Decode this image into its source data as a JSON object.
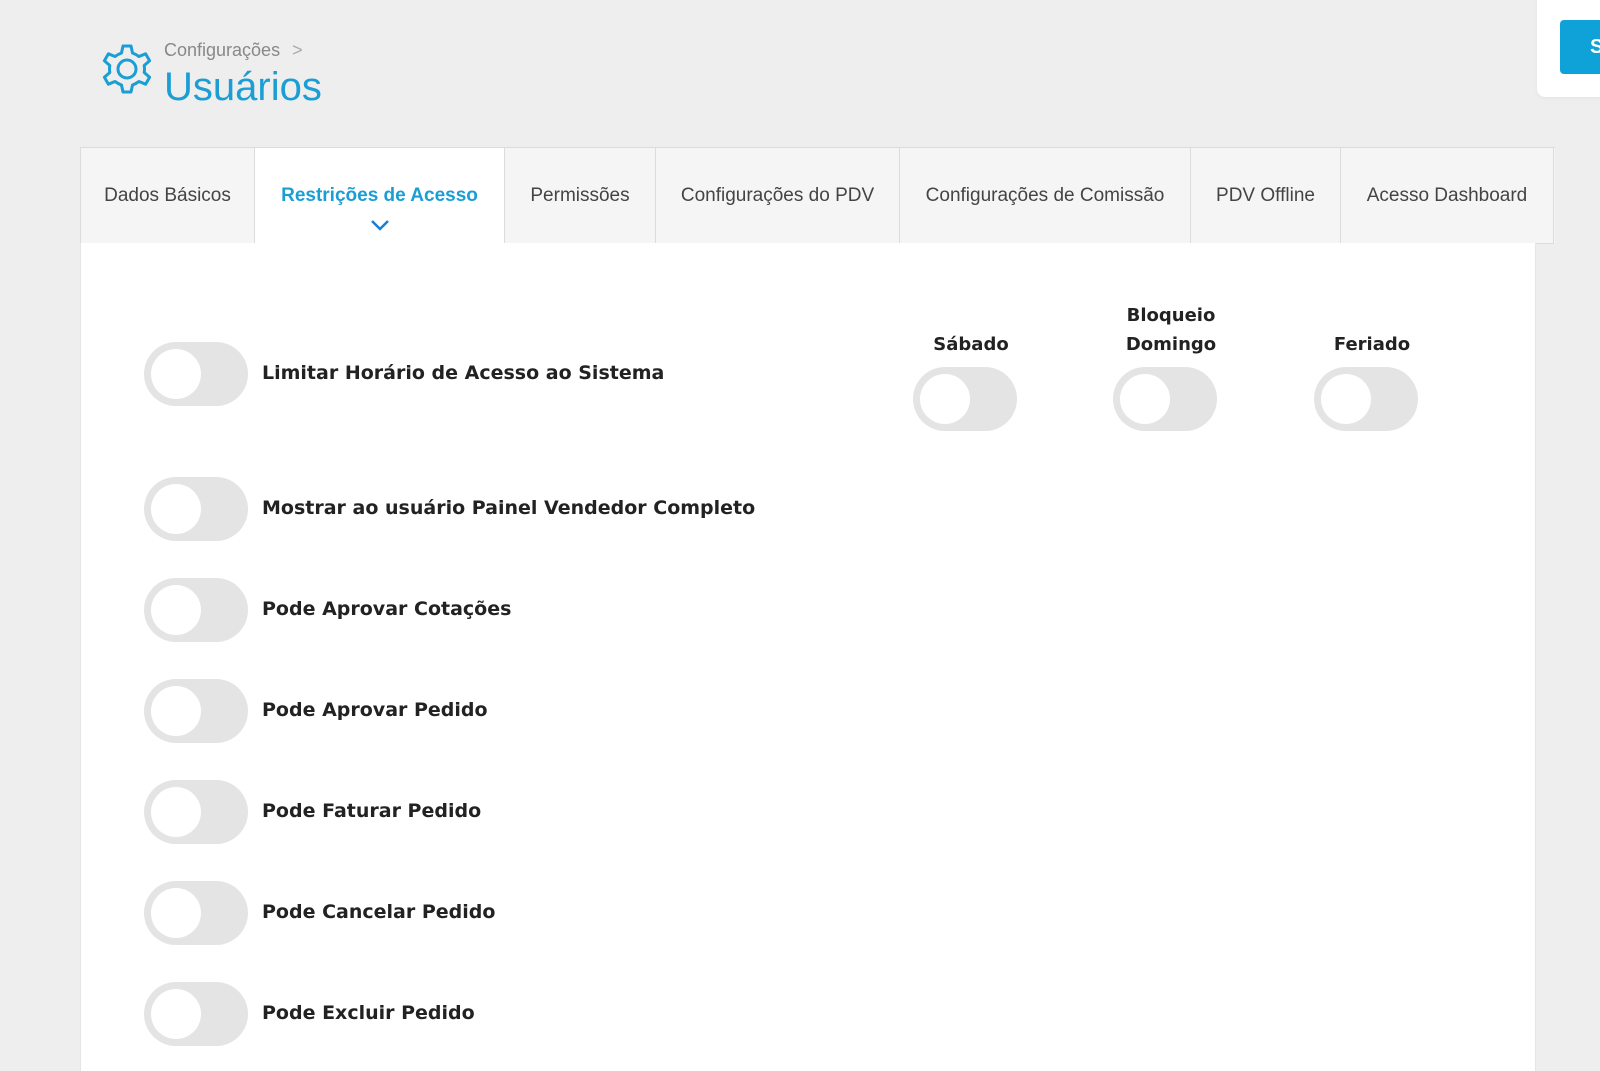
{
  "breadcrumb": {
    "parent": "Configurações",
    "separator": ">"
  },
  "page": {
    "title": "Usuários"
  },
  "toolbar": {
    "save_label": "S"
  },
  "tabs": [
    {
      "label": "Dados Básicos",
      "active": false
    },
    {
      "label": "Restrições de Acesso",
      "active": true
    },
    {
      "label": "Permissões",
      "active": false
    },
    {
      "label": "Configurações do PDV",
      "active": false
    },
    {
      "label": "Configurações de Comissão",
      "active": false
    },
    {
      "label": "PDV Offline",
      "active": false
    },
    {
      "label": "Acesso Dashboard",
      "active": false
    }
  ],
  "restrictions": {
    "limit_access": {
      "label": "Limitar Horário de Acesso ao Sistema",
      "enabled": false
    },
    "days": [
      {
        "label": "Sábado",
        "enabled": false
      },
      {
        "label_line1": "Bloqueio",
        "label_line2": "Domingo",
        "enabled": false
      },
      {
        "label": "Feriado",
        "enabled": false
      }
    ],
    "options": [
      {
        "label": "Mostrar ao usuário Painel Vendedor Completo",
        "enabled": false
      },
      {
        "label": "Pode Aprovar Cotações",
        "enabled": false
      },
      {
        "label": "Pode Aprovar Pedido",
        "enabled": false
      },
      {
        "label": "Pode Faturar Pedido",
        "enabled": false
      },
      {
        "label": "Pode Cancelar Pedido",
        "enabled": false
      },
      {
        "label": "Pode Excluir Pedido",
        "enabled": false
      }
    ]
  },
  "colors": {
    "accent": "#1a9ed4",
    "button": "#0fa2d8",
    "toggle_off": "#e4e4e4",
    "background": "#eeeeee"
  }
}
